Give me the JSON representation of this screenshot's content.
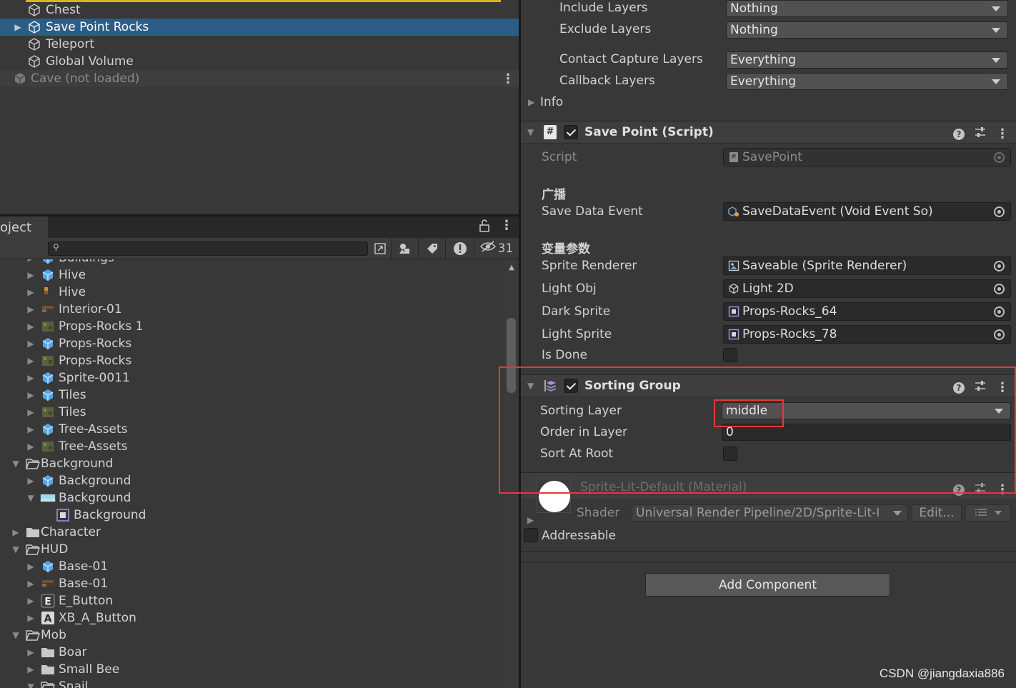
{
  "hierarchy": {
    "items": [
      {
        "label": "Chest"
      },
      {
        "label": "Save Point Rocks"
      },
      {
        "label": "Teleport"
      },
      {
        "label": "Global Volume"
      }
    ],
    "unloaded_scene": "Cave (not loaded)"
  },
  "project": {
    "tab_label": "oject",
    "search_placeholder": "",
    "hidden_count": "31",
    "tree": [
      {
        "label": "Buildings"
      },
      {
        "label": "Hive"
      },
      {
        "label": "Hive"
      },
      {
        "label": "Interior-01"
      },
      {
        "label": "Props-Rocks 1"
      },
      {
        "label": "Props-Rocks"
      },
      {
        "label": "Props-Rocks"
      },
      {
        "label": "Sprite-0011"
      },
      {
        "label": "Tiles"
      },
      {
        "label": "Tiles"
      },
      {
        "label": "Tree-Assets"
      },
      {
        "label": "Tree-Assets"
      },
      {
        "label": "Background"
      },
      {
        "label": "Background"
      },
      {
        "label": "Background"
      },
      {
        "label": "Background"
      },
      {
        "label": "Character"
      },
      {
        "label": "HUD"
      },
      {
        "label": "Base-01"
      },
      {
        "label": "Base-01"
      },
      {
        "label": "E_Button"
      },
      {
        "label": "XB_A_Button"
      },
      {
        "label": "Mob"
      },
      {
        "label": "Boar"
      },
      {
        "label": "Small Bee"
      },
      {
        "label": "Snail"
      }
    ]
  },
  "inspector": {
    "layers": {
      "include_label": "Include Layers",
      "include_value": "Nothing",
      "exclude_label": "Exclude Layers",
      "exclude_value": "Nothing",
      "contact_label": "Contact Capture Layers",
      "contact_value": "Everything",
      "callback_label": "Callback Layers",
      "callback_value": "Everything",
      "info_label": "Info"
    },
    "save_point": {
      "title": "Save Point (Script)",
      "script_label": "Script",
      "script_value": "SavePoint",
      "section_broadcast": "广播",
      "save_data_event_label": "Save Data Event",
      "save_data_event_value": "SaveDataEvent (Void Event So)",
      "section_vars": "变量参数",
      "sprite_renderer_label": "Sprite Renderer",
      "sprite_renderer_value": "Saveable (Sprite Renderer)",
      "light_obj_label": "Light Obj",
      "light_obj_value": "Light 2D",
      "dark_sprite_label": "Dark Sprite",
      "dark_sprite_value": "Props-Rocks_64",
      "light_sprite_label": "Light Sprite",
      "light_sprite_value": "Props-Rocks_78",
      "is_done_label": "Is Done"
    },
    "sorting_group": {
      "title": "Sorting Group",
      "sorting_layer_label": "Sorting Layer",
      "sorting_layer_value": "middle",
      "order_label": "Order in Layer",
      "order_value": "0",
      "sort_at_root_label": "Sort At Root"
    },
    "material": {
      "title": "Sprite-Lit-Default (Material)",
      "shader_label": "Shader",
      "shader_value": "Universal Render Pipeline/2D/Sprite-Lit-I",
      "edit_label": "Edit..."
    },
    "addressable_label": "Addressable",
    "add_component_label": "Add Component"
  },
  "watermark": "CSDN @jiangdaxia886",
  "colors": {
    "selection": "#2c5d87",
    "highlight_box": "#e53935",
    "accent_bar": "#e0b020"
  }
}
